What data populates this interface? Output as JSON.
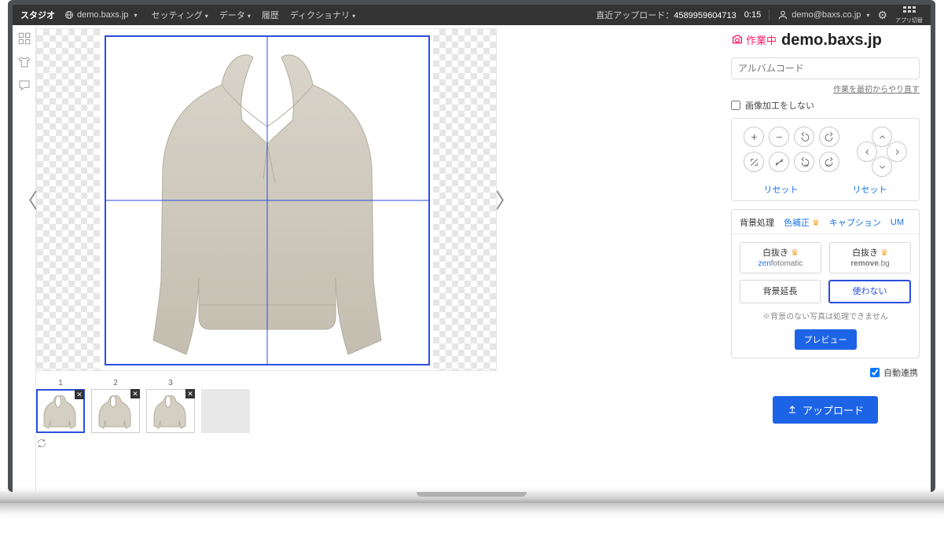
{
  "topbar": {
    "brand": "スタジオ",
    "domain": "demo.baxs.jp",
    "menus": {
      "settings": "セッティング",
      "data": "データ",
      "history": "履歴",
      "dictionary": "ディクショナリ"
    },
    "upload_label": "直近アップロード：",
    "upload_id": "4589959604713",
    "timer": "0:15",
    "user": "demo@baxs.co.jp",
    "apps_label": "アプリ切替"
  },
  "header": {
    "status": "作業中",
    "domain": "demo.baxs.jp"
  },
  "album": {
    "placeholder": "アルバムコード"
  },
  "links": {
    "restart": "作業を最初からやり直す"
  },
  "checkbox": {
    "no_process": "画像加工をしない",
    "auto_link": "自動連携"
  },
  "reset": "リセット",
  "tabs": {
    "bg": "背景処理",
    "color": "色補正",
    "caption": "キャプション",
    "um": "UM"
  },
  "options": {
    "zen_title": "白抜き",
    "zen_sub_a": "zen",
    "zen_sub_b": "fotomatic",
    "rem_title": "白抜き",
    "rem_sub_a": "remove",
    "rem_sub_b": ".bg",
    "extend": "背景延長",
    "none": "使わない"
  },
  "note": "※背景のない写真は処理できません",
  "preview": "プレビュー",
  "upload": "アップロード",
  "thumbs": {
    "n1": "1",
    "n2": "2",
    "n3": "3"
  }
}
